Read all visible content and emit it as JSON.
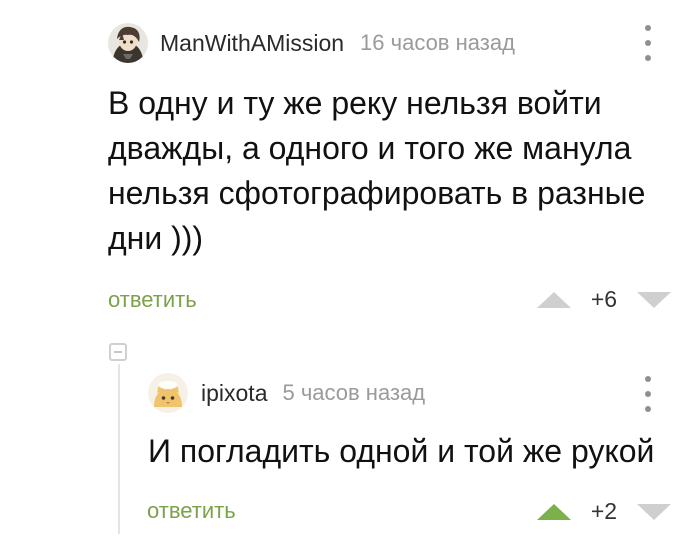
{
  "comments": [
    {
      "author": "ManWithAMission",
      "time": "16 часов назад",
      "text": "В одну и ту же реку нельзя войти дважды, а одного и того же манула нельзя сфотографировать в разные дни )))",
      "reply_label": "ответить",
      "rating": "+6",
      "upvoted": false,
      "avatar_icon": "user-avatar-anime-icon"
    },
    {
      "author": "ipixota",
      "time": "5 часов назад",
      "text": "И погладить одной и той же рукой",
      "reply_label": "ответить",
      "rating": "+2",
      "upvoted": true,
      "avatar_icon": "user-avatar-cat-icon"
    }
  ],
  "colors": {
    "accent": "#7ba24a",
    "upvote_active": "#7bb04a",
    "muted": "#9a9a9a",
    "arrow_inactive": "#cfcfcf"
  }
}
